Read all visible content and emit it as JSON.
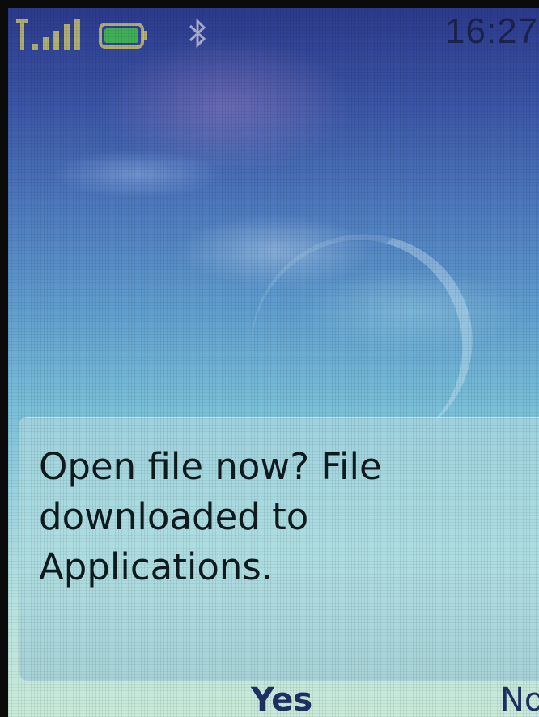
{
  "status_bar": {
    "clock": "16:27",
    "signal_icon": "signal-strength-icon",
    "battery_icon": "battery-icon",
    "bluetooth_icon": "bluetooth-icon",
    "accent_color": "#c8c16a"
  },
  "dialog": {
    "message": "Open file now? File downloaded to Applications."
  },
  "softkeys": {
    "left_label": "Yes",
    "right_label": "No"
  }
}
